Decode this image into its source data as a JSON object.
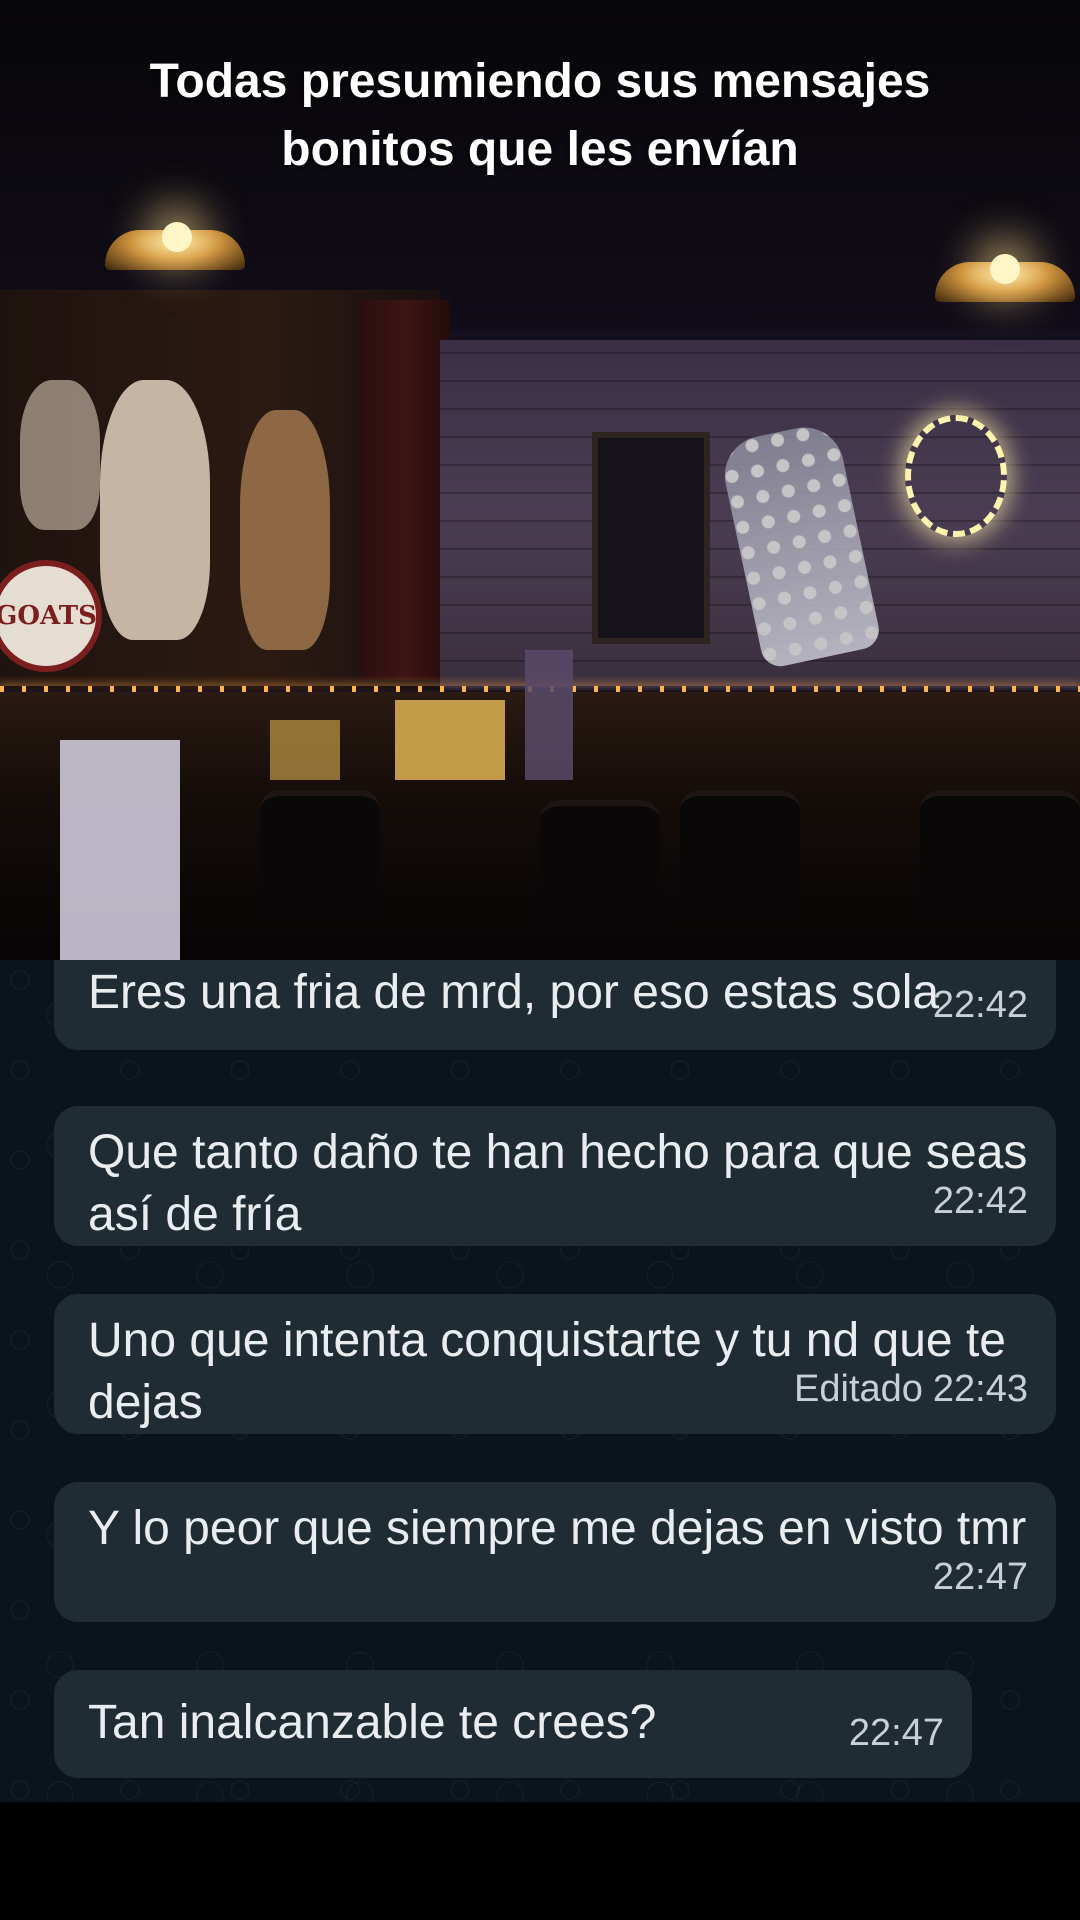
{
  "caption": "Todas presumiendo sus mensajes bonitos que les envían",
  "photo": {
    "sign_text": "GOATS"
  },
  "messages": [
    {
      "text": "Eres una fria de mrd, por eso estas sola",
      "time": "22:42",
      "edited": ""
    },
    {
      "text": "Que tanto daño te han hecho para que seas así de fría",
      "time": "22:42",
      "edited": ""
    },
    {
      "text": "Uno que intenta conquistarte y tu nd que te dejas",
      "time": "22:43",
      "edited": "Editado"
    },
    {
      "text": "Y lo peor que siempre me dejas en visto tmr",
      "time": "22:47",
      "edited": ""
    },
    {
      "text": "Tan inalcanzable te crees?",
      "time": "22:47",
      "edited": ""
    }
  ],
  "colors": {
    "chat_background": "#0b141a",
    "bubble": "#1f2c34",
    "bubble_text": "#e9edef"
  }
}
